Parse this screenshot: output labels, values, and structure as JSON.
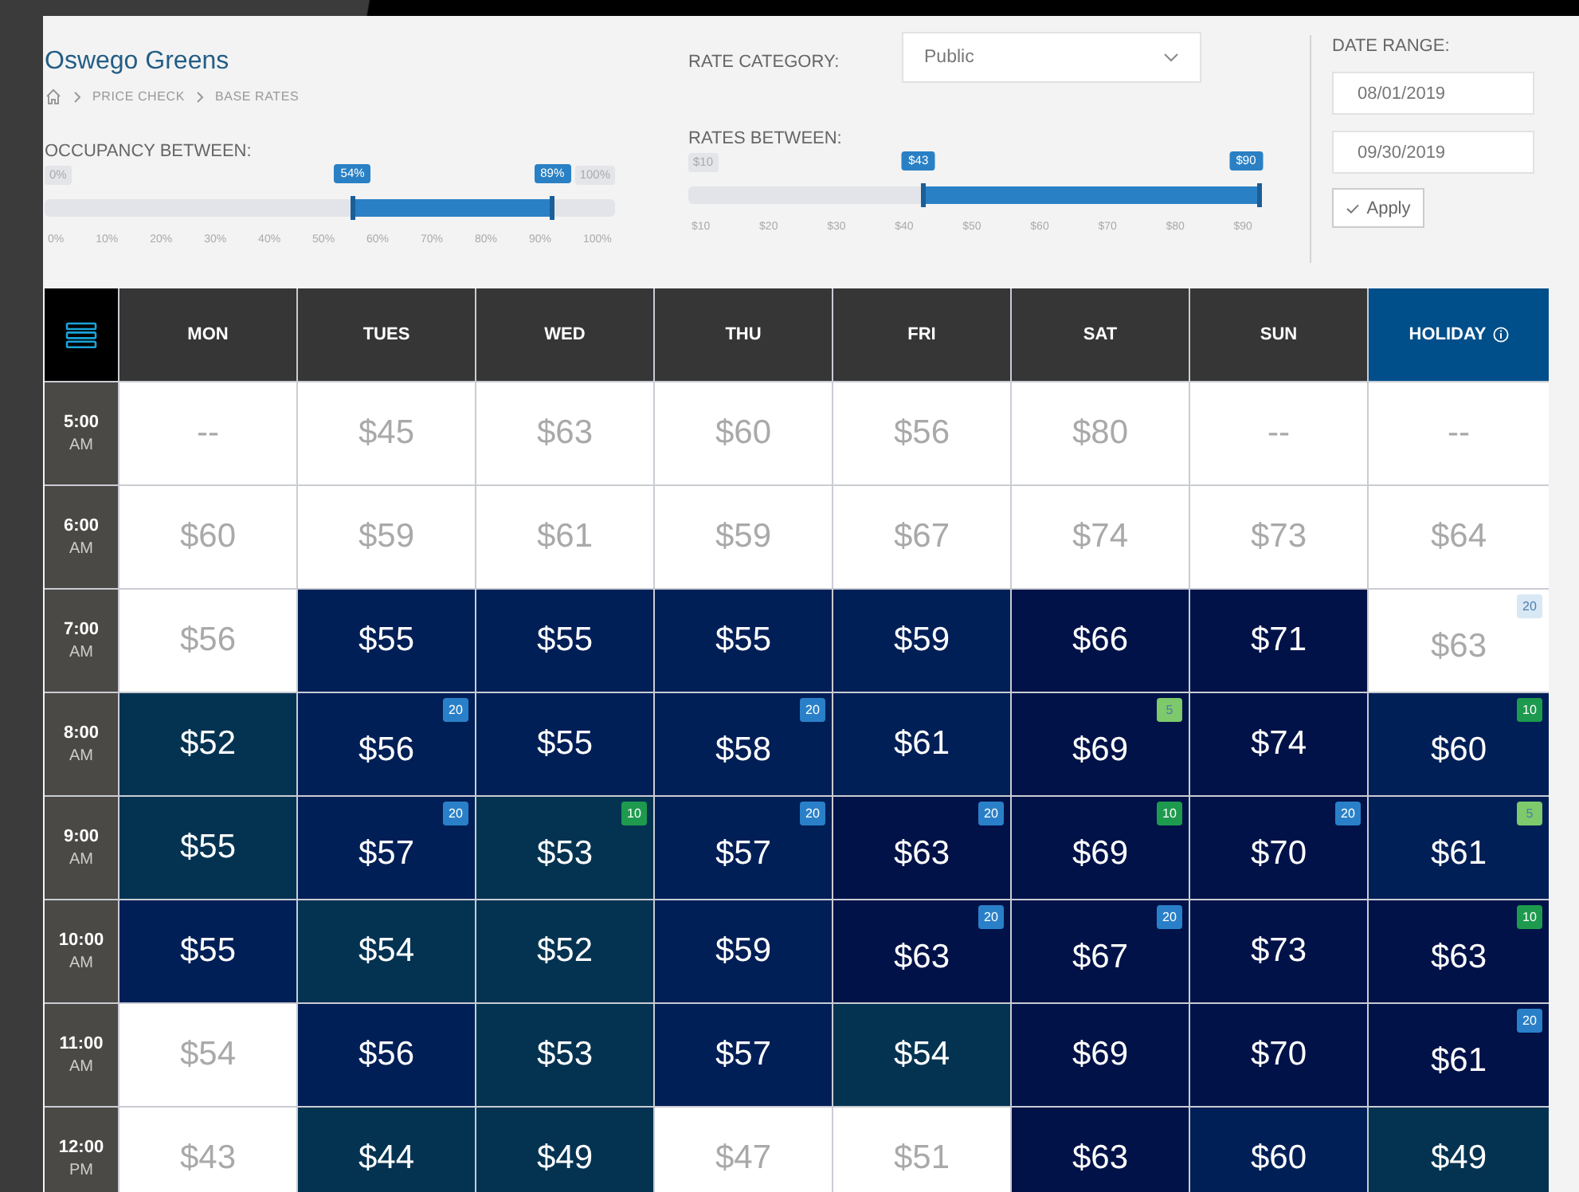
{
  "page": {
    "title": "Oswego Greens",
    "breadcrumb": [
      "PRICE CHECK",
      "BASE RATES"
    ]
  },
  "filters": {
    "rate_category": {
      "label": "RATE CATEGORY:",
      "value": "Public"
    },
    "occupancy": {
      "label": "OCCUPANCY BETWEEN:",
      "min_label": "0%",
      "max_label": "100%",
      "handles": [
        {
          "label": "54%",
          "level": 0.54
        },
        {
          "label": "89%",
          "level": 0.89
        }
      ],
      "ticks": [
        "0%",
        "10%",
        "20%",
        "30%",
        "40%",
        "50%",
        "60%",
        "70%",
        "80%",
        "90%",
        "100%"
      ]
    },
    "rates": {
      "label": "RATES BETWEEN:",
      "min_label": "$10",
      "handles": [
        {
          "label": "$43",
          "level": 0.4125
        },
        {
          "label": "$90",
          "level": 1
        }
      ],
      "ticks": [
        "$10",
        "$20",
        "$30",
        "$40",
        "$50",
        "$60",
        "$70",
        "$80",
        "$90"
      ]
    },
    "date_range": {
      "label": "DATE RANGE:",
      "start": "08/01/2019",
      "end": "09/30/2019",
      "apply": "Apply"
    }
  },
  "grid": {
    "columns": [
      {
        "label": "MON",
        "kind": "day"
      },
      {
        "label": "TUES",
        "kind": "day"
      },
      {
        "label": "WED",
        "kind": "day"
      },
      {
        "label": "THU",
        "kind": "day"
      },
      {
        "label": "FRI",
        "kind": "day"
      },
      {
        "label": "SAT",
        "kind": "day"
      },
      {
        "label": "SUN",
        "kind": "day"
      },
      {
        "label": "HOLIDAY",
        "kind": "holiday"
      }
    ],
    "rows": [
      {
        "time": "5:00",
        "period": "AM",
        "cells": [
          {
            "price": "--",
            "color": "#ffffff"
          },
          {
            "price": "$45",
            "color": "#ffffff"
          },
          {
            "price": "$63",
            "color": "#ffffff"
          },
          {
            "price": "$60",
            "color": "#ffffff"
          },
          {
            "price": "$56",
            "color": "#ffffff"
          },
          {
            "price": "$80",
            "color": "#ffffff"
          },
          {
            "price": "--",
            "color": "#ffffff"
          },
          {
            "price": "--",
            "color": "#ffffff"
          }
        ]
      },
      {
        "time": "6:00",
        "period": "AM",
        "cells": [
          {
            "price": "$60",
            "color": "#ffffff"
          },
          {
            "price": "$59",
            "color": "#ffffff"
          },
          {
            "price": "$61",
            "color": "#ffffff"
          },
          {
            "price": "$59",
            "color": "#ffffff"
          },
          {
            "price": "$67",
            "color": "#ffffff"
          },
          {
            "price": "$74",
            "color": "#ffffff"
          },
          {
            "price": "$73",
            "color": "#ffffff"
          },
          {
            "price": "$64",
            "color": "#ffffff"
          }
        ]
      },
      {
        "time": "7:00",
        "period": "AM",
        "cells": [
          {
            "price": "$56",
            "color": "#ffffff"
          },
          {
            "price": "$55",
            "color": "#001f57"
          },
          {
            "price": "$55",
            "color": "#001f57"
          },
          {
            "price": "$55",
            "color": "#001f57"
          },
          {
            "price": "$59",
            "color": "#001f57"
          },
          {
            "price": "$66",
            "color": "#001248"
          },
          {
            "price": "$71",
            "color": "#001248"
          },
          {
            "price": "$63",
            "color": "#ffffff",
            "badge": {
              "text": "20",
              "color": "#d9e8f5"
            }
          }
        ]
      },
      {
        "time": "8:00",
        "period": "AM",
        "cells": [
          {
            "price": "$52",
            "color": "#043352"
          },
          {
            "price": "$56",
            "color": "#001f57",
            "badge": {
              "text": "20",
              "color": "#2a80c8"
            }
          },
          {
            "price": "$55",
            "color": "#001f57"
          },
          {
            "price": "$58",
            "color": "#001f57",
            "badge": {
              "text": "20",
              "color": "#2a80c8"
            }
          },
          {
            "price": "$61",
            "color": "#001f57"
          },
          {
            "price": "$69",
            "color": "#001248",
            "badge": {
              "text": "5",
              "color": "#7dc96b"
            }
          },
          {
            "price": "$74",
            "color": "#001248"
          },
          {
            "price": "$60",
            "color": "#001f57",
            "badge": {
              "text": "10",
              "color": "#1e9a4e"
            }
          }
        ]
      },
      {
        "time": "9:00",
        "period": "AM",
        "cells": [
          {
            "price": "$55",
            "color": "#043352"
          },
          {
            "price": "$57",
            "color": "#001f57",
            "badge": {
              "text": "20",
              "color": "#2a80c8"
            }
          },
          {
            "price": "$53",
            "color": "#043352",
            "badge": {
              "text": "10",
              "color": "#1e9a4e"
            }
          },
          {
            "price": "$57",
            "color": "#001f57",
            "badge": {
              "text": "20",
              "color": "#2a80c8"
            }
          },
          {
            "price": "$63",
            "color": "#001248",
            "badge": {
              "text": "20",
              "color": "#2a80c8"
            }
          },
          {
            "price": "$69",
            "color": "#001248",
            "badge": {
              "text": "10",
              "color": "#1e9a4e"
            }
          },
          {
            "price": "$70",
            "color": "#001248",
            "badge": {
              "text": "20",
              "color": "#2a80c8"
            }
          },
          {
            "price": "$61",
            "color": "#001f57",
            "badge": {
              "text": "5",
              "color": "#7dc96b"
            }
          }
        ]
      },
      {
        "time": "10:00",
        "period": "AM",
        "cells": [
          {
            "price": "$55",
            "color": "#001f57"
          },
          {
            "price": "$54",
            "color": "#043352"
          },
          {
            "price": "$52",
            "color": "#043352"
          },
          {
            "price": "$59",
            "color": "#001f57"
          },
          {
            "price": "$63",
            "color": "#001248",
            "badge": {
              "text": "20",
              "color": "#2a80c8"
            }
          },
          {
            "price": "$67",
            "color": "#001248",
            "badge": {
              "text": "20",
              "color": "#2a80c8"
            }
          },
          {
            "price": "$73",
            "color": "#001248"
          },
          {
            "price": "$63",
            "color": "#001248",
            "badge": {
              "text": "10",
              "color": "#1e9a4e"
            }
          }
        ]
      },
      {
        "time": "11:00",
        "period": "AM",
        "cells": [
          {
            "price": "$54",
            "color": "#ffffff"
          },
          {
            "price": "$56",
            "color": "#001f57"
          },
          {
            "price": "$53",
            "color": "#043352"
          },
          {
            "price": "$57",
            "color": "#001f57"
          },
          {
            "price": "$54",
            "color": "#043352"
          },
          {
            "price": "$69",
            "color": "#001248"
          },
          {
            "price": "$70",
            "color": "#001248"
          },
          {
            "price": "$61",
            "color": "#001248",
            "badge": {
              "text": "20",
              "color": "#2a80c8"
            }
          }
        ]
      },
      {
        "time": "12:00",
        "period": "PM",
        "cells": [
          {
            "price": "$43",
            "color": "#ffffff"
          },
          {
            "price": "$44",
            "color": "#043352"
          },
          {
            "price": "$49",
            "color": "#043352"
          },
          {
            "price": "$47",
            "color": "#ffffff"
          },
          {
            "price": "$51",
            "color": "#ffffff"
          },
          {
            "price": "$63",
            "color": "#001248"
          },
          {
            "price": "$60",
            "color": "#001f57"
          },
          {
            "price": "$49",
            "color": "#043352"
          }
        ]
      }
    ]
  }
}
